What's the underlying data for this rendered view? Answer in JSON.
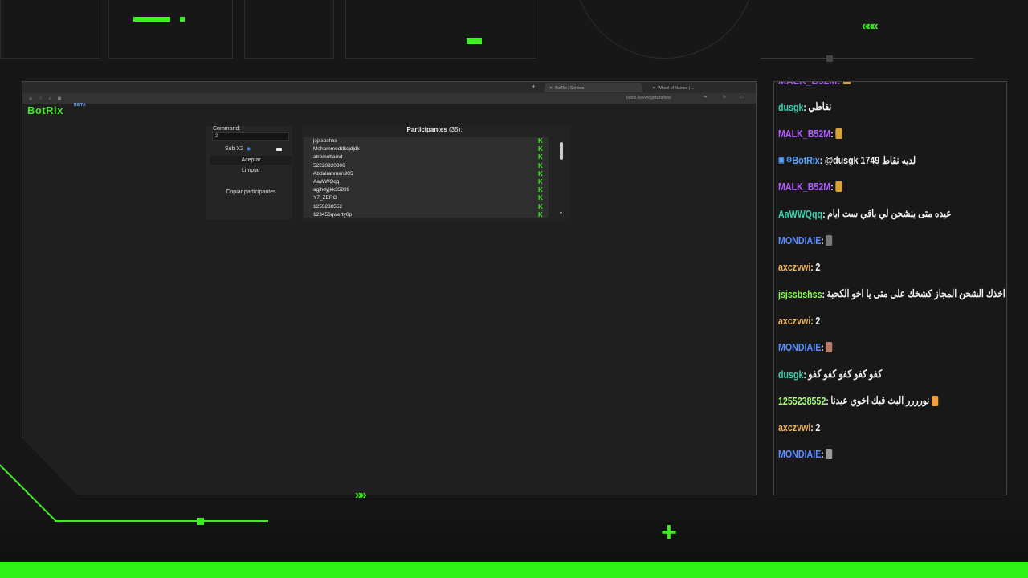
{
  "browser": {
    "tabs": [
      {
        "label": "BotRix | Sorteos",
        "active": true
      },
      {
        "label": "Wheel of Names | ...",
        "active": false
      }
    ],
    "url": "botrix.live/widgets/raffles/"
  },
  "botrix": {
    "logo": "BotRix",
    "beta": "BETA",
    "command_label": "Command:",
    "command_value": "2",
    "sub_label": "Sub X2",
    "accept_label": "Aceptar",
    "clear_label": "Limpiar",
    "copy_label": "Copiar participantes",
    "participants_title": "Participantes",
    "participants_count": "(35):",
    "participants": [
      "jsjssbshss",
      "Mohammeddkcjdjdk",
      "atromohamd",
      "52220920806",
      "Abdalrahman905",
      "AaWWQqq",
      "agjhdyjkk35899",
      "Y7_ZERO",
      "1255238552",
      "123456qwerty0p"
    ]
  },
  "chat": {
    "messages": [
      {
        "user": "dusgk",
        "color": "#3bd1b0",
        "text": "نقاطي"
      },
      {
        "user": "MALK_B52M",
        "color": "#b15bff",
        "text": "",
        "emote": "#d6a23a"
      },
      {
        "user": "BotRix",
        "color": "#5aa7ff",
        "text": "@dusgk 1749 لديه نقاط",
        "bot": true
      },
      {
        "user": "MALK_B52M",
        "color": "#b15bff",
        "text": "",
        "emote": "#d6a23a"
      },
      {
        "user": "AaWWQqq",
        "color": "#3bd1b0",
        "text": "عيده متى ينشحن لي باقي ست ايام"
      },
      {
        "user": "MONDIAIE",
        "color": "#5a8cff",
        "text": "",
        "emote": "#777"
      },
      {
        "user": "axczvwi",
        "color": "#f0b45a",
        "text": "2"
      },
      {
        "user": "jsjssbshss",
        "color": "#86ff4a",
        "text": "ئس اخذك الشحن المجاز كشخك على متى يا اخو الكحبة"
      },
      {
        "user": "axczvwi",
        "color": "#f0b45a",
        "text": "2"
      },
      {
        "user": "MONDIAIE",
        "color": "#5a8cff",
        "text": "",
        "emote": "#b77a6a"
      },
      {
        "user": "dusgk",
        "color": "#3bd1b0",
        "text": "كفو كفو كفو كفو كفو"
      },
      {
        "user": "1255238552",
        "color": "#a6ff7a",
        "text": "نورررر البث قبك اخوي عيدنا",
        "emote": "#f0a040"
      },
      {
        "user": "axczvwi",
        "color": "#f0b45a",
        "text": "2"
      },
      {
        "user": "MONDIAIE",
        "color": "#5a8cff",
        "text": "",
        "emote": "#999"
      }
    ]
  },
  "colors": {
    "accent": "#3df01f",
    "background": "#171717"
  }
}
